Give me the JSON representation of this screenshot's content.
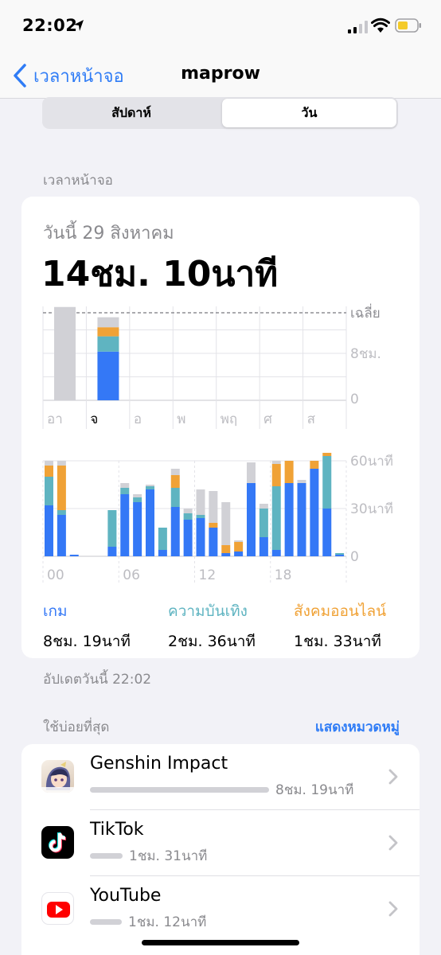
{
  "status": {
    "time": "22:02"
  },
  "nav": {
    "back_label": "เวลาหน้าจอ",
    "title": "maprow"
  },
  "segments": {
    "week": "สัปดาห์",
    "day": "วัน"
  },
  "section_screen_time": "เวลาหน้าจอ",
  "summary": {
    "date_label": "วันนี้ 29 สิงหาคม",
    "total": "14ชม. 10นาที"
  },
  "colors": {
    "games": "#3478f6",
    "entertainment": "#5fb4c1",
    "social": "#f0a236",
    "other": "#d1d1d6",
    "accent": "#2f7cf6"
  },
  "chart_data": [
    {
      "type": "bar",
      "stacked": true,
      "categories": [
        "อา",
        "จ",
        "อ",
        "พ",
        "พฤ",
        "ศ",
        "ส"
      ],
      "y_tick_labels": [
        "0",
        "8ชม."
      ],
      "average_label": "เฉลี่ย",
      "ylim_hours": [
        0,
        16
      ],
      "series": [
        {
          "name": "เกม",
          "values": [
            0,
            8.3,
            0,
            0,
            0,
            0,
            0
          ]
        },
        {
          "name": "ความบันเทิง",
          "values": [
            0,
            2.6,
            0,
            0,
            0,
            0,
            0
          ]
        },
        {
          "name": "สังคมออนไลน์",
          "values": [
            0,
            1.55,
            0,
            0,
            0,
            0,
            0
          ]
        },
        {
          "values": [
            15.9,
            1.7,
            0,
            0,
            0,
            0,
            0
          ]
        }
      ]
    },
    {
      "type": "bar",
      "stacked": true,
      "x_tick_labels": [
        "00",
        "06",
        "12",
        "18"
      ],
      "y_tick_labels": [
        "0",
        "30นาที",
        "60นาที"
      ],
      "ylim_minutes": [
        0,
        60
      ],
      "hours": [
        0,
        1,
        2,
        3,
        4,
        5,
        6,
        7,
        8,
        9,
        10,
        11,
        12,
        13,
        14,
        15,
        16,
        17,
        18,
        19,
        20,
        21,
        22,
        23
      ],
      "series": [
        {
          "name": "เกม",
          "values": [
            32,
            26,
            1,
            0,
            0,
            6,
            39,
            34,
            42,
            4,
            31,
            23,
            24,
            18,
            2,
            3,
            46,
            12,
            4,
            46,
            46,
            55,
            30,
            1
          ]
        },
        {
          "name": "ความบันเทิง",
          "values": [
            18,
            3,
            0,
            0,
            0,
            23,
            4,
            3,
            2,
            14,
            12,
            4,
            2,
            0,
            0,
            0,
            0,
            18,
            40,
            0,
            0,
            0,
            33,
            1
          ]
        },
        {
          "name": "สังคมออนไลน์",
          "values": [
            7,
            28,
            0,
            0,
            0,
            0,
            0,
            0,
            0,
            0,
            8,
            0,
            0,
            3,
            5,
            6,
            0,
            0,
            14,
            14,
            0,
            5,
            6,
            0
          ]
        },
        {
          "values": [
            3,
            3,
            0,
            0,
            0,
            0,
            3,
            2,
            1,
            0,
            4,
            3,
            16,
            20,
            27,
            1,
            13,
            3,
            2,
            0,
            2,
            0,
            0,
            0
          ]
        }
      ]
    }
  ],
  "categories": [
    {
      "name": "เกม",
      "value": "8ชม. 19นาที"
    },
    {
      "name": "ความบันเทิง",
      "value": "2ชม. 36นาที"
    },
    {
      "name": "สังคมออนไลน์",
      "value": "1ชม. 33นาที"
    }
  ],
  "updated_label": "อัปเดตวันนี้ 22:02",
  "most_used": {
    "label": "ใช้บ่อยที่สุด",
    "show_categories": "แสดงหมวดหมู่",
    "apps": [
      {
        "name": "Genshin Impact",
        "time": "8ชม. 19นาที",
        "icon": "genshin-impact-icon",
        "usage_fraction": 1.0
      },
      {
        "name": "TikTok",
        "time": "1ชม. 31นาที",
        "icon": "tiktok-icon",
        "usage_fraction": 0.18
      },
      {
        "name": "YouTube",
        "time": "1ชม. 12นาที",
        "icon": "youtube-icon",
        "usage_fraction": 0.15
      }
    ]
  }
}
